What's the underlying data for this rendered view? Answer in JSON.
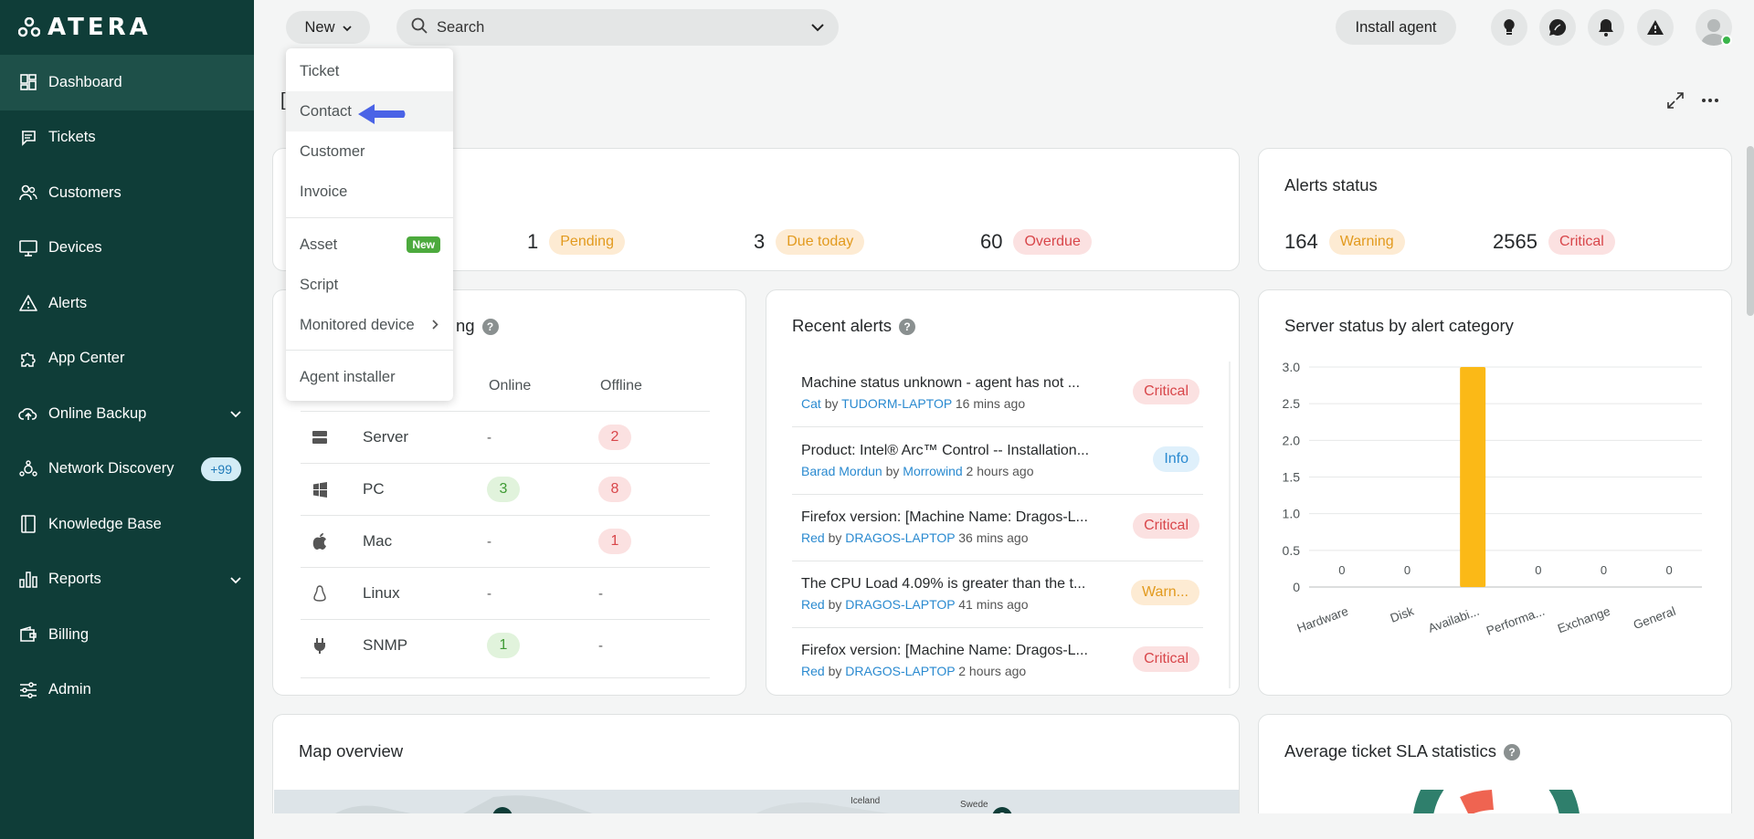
{
  "app": {
    "logo_text": "ATERA"
  },
  "sidebar": {
    "items": [
      {
        "label": "Dashboard",
        "icon": "dashboard-icon",
        "active": true
      },
      {
        "label": "Tickets",
        "icon": "ticket-icon"
      },
      {
        "label": "Customers",
        "icon": "customers-icon"
      },
      {
        "label": "Devices",
        "icon": "devices-icon"
      },
      {
        "label": "Alerts",
        "icon": "alert-triangle-icon"
      },
      {
        "label": "App Center",
        "icon": "puzzle-icon"
      },
      {
        "label": "Online Backup",
        "icon": "cloud-upload-icon",
        "expandable": true
      },
      {
        "label": "Network Discovery",
        "icon": "network-icon",
        "badge": "+99"
      },
      {
        "label": "Knowledge Base",
        "icon": "book-icon"
      },
      {
        "label": "Reports",
        "icon": "bar-chart-icon",
        "expandable": true
      },
      {
        "label": "Billing",
        "icon": "wallet-icon"
      },
      {
        "label": "Admin",
        "icon": "sliders-icon"
      }
    ]
  },
  "topbar": {
    "new_label": "New",
    "search_placeholder": "Search",
    "install_agent_label": "Install agent"
  },
  "new_menu": {
    "items": [
      {
        "label": "Ticket"
      },
      {
        "label": "Contact",
        "highlighted": true
      },
      {
        "label": "Customer"
      },
      {
        "label": "Invoice"
      },
      {
        "label": "Asset",
        "badge": "New"
      },
      {
        "label": "Script"
      },
      {
        "label": "Monitored device",
        "has_submenu": true
      },
      {
        "label": "Agent installer"
      }
    ]
  },
  "page": {
    "title_fragment": "["
  },
  "tickets_status": {
    "pending": {
      "count": "1",
      "label": "Pending"
    },
    "due_today": {
      "count": "3",
      "label": "Due today"
    },
    "overdue": {
      "count": "60",
      "label": "Overdue"
    }
  },
  "alerts_status": {
    "title": "Alerts status",
    "warning": {
      "count": "164",
      "label": "Warning"
    },
    "critical": {
      "count": "2565",
      "label": "Critical"
    }
  },
  "monitoring": {
    "title_fragment": "ng",
    "col_online": "Online",
    "col_offline": "Offline",
    "rows": [
      {
        "name": "Server",
        "online": "-",
        "offline": "2",
        "icon": "server-icon"
      },
      {
        "name": "PC",
        "online": "3",
        "offline": "8",
        "icon": "windows-icon"
      },
      {
        "name": "Mac",
        "online": "-",
        "offline": "1",
        "icon": "apple-icon"
      },
      {
        "name": "Linux",
        "online": "-",
        "offline": "-",
        "icon": "linux-icon"
      },
      {
        "name": "SNMP",
        "online": "1",
        "offline": "-",
        "icon": "plug-icon"
      }
    ]
  },
  "recent_alerts": {
    "title": "Recent alerts",
    "items": [
      {
        "title": "Machine status unknown - agent has not ...",
        "customer": "Cat",
        "by": "by",
        "device": "TUDORM-LAPTOP",
        "time": "16 mins ago",
        "severity": "Critical",
        "type": "crit"
      },
      {
        "title": "Product: Intel® Arc™ Control -- Installation...",
        "customer": "Barad Mordun",
        "by": "by",
        "device": "Morrowind",
        "time": "2 hours ago",
        "severity": "Info",
        "type": "info"
      },
      {
        "title": "Firefox version: [Machine Name: Dragos-L...",
        "customer": "Red",
        "by": "by",
        "device": "DRAGOS-LAPTOP",
        "time": "36 mins ago",
        "severity": "Critical",
        "type": "crit"
      },
      {
        "title": "The CPU Load 4.09% is greater than the t...",
        "customer": "Red",
        "by": "by",
        "device": "DRAGOS-LAPTOP",
        "time": "41 mins ago",
        "severity": "Warn...",
        "type": "warn"
      },
      {
        "title": "Firefox version: [Machine Name: Dragos-L...",
        "customer": "Red",
        "by": "by",
        "device": "DRAGOS-LAPTOP",
        "time": "2 hours ago",
        "severity": "Critical",
        "type": "crit"
      }
    ]
  },
  "server_status_card": {
    "title": "Server status by alert category"
  },
  "chart_data": {
    "type": "bar",
    "categories": [
      "Hardware",
      "Disk",
      "Availabi...",
      "Performa...",
      "Exchange",
      "General"
    ],
    "values": [
      0,
      0,
      3,
      0,
      0,
      0
    ],
    "ylim": [
      0,
      3
    ],
    "yticks": [
      "0",
      "0.5",
      "1.0",
      "1.5",
      "2.0",
      "2.5",
      "3.0"
    ],
    "bar_color": "#fbb917",
    "grid": true
  },
  "map_overview": {
    "title": "Map overview",
    "labels": [
      "Iceland",
      "Swede"
    ]
  },
  "sla_card": {
    "title": "Average ticket SLA statistics"
  },
  "colors": {
    "sidebar_bg": "#0f3d38",
    "accent_blue": "#4a63e6",
    "badge_green": "#4caa3d"
  }
}
